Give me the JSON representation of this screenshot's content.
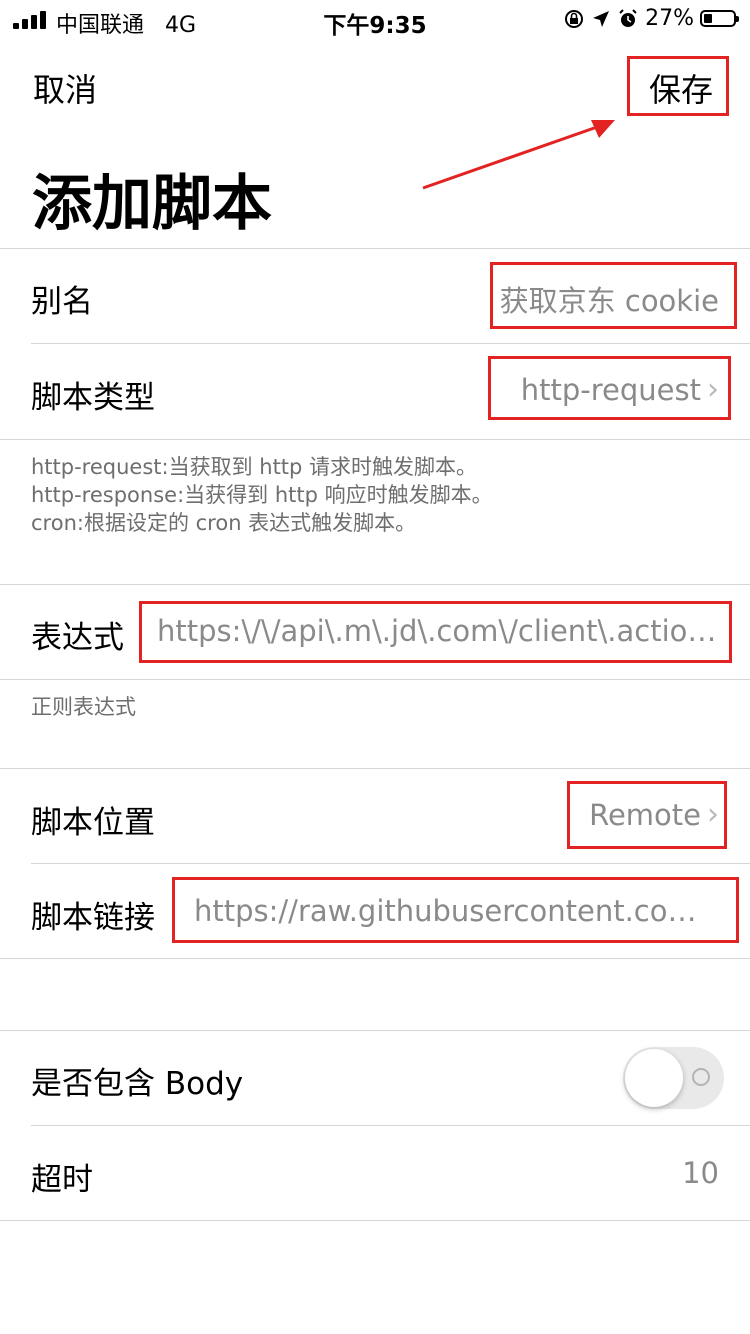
{
  "status_bar": {
    "carrier": "中国联通",
    "network": "4G",
    "time": "下午9:35",
    "battery": "27%",
    "icons": [
      "signal-icon",
      "rotation-lock-icon",
      "location-arrow-icon",
      "alarm-icon",
      "battery-icon"
    ]
  },
  "nav": {
    "cancel_label": "取消",
    "save_label": "保存",
    "title": "添加脚本"
  },
  "form": {
    "alias": {
      "label": "别名",
      "placeholder": "获取京东 cookie"
    },
    "script_type": {
      "label": "脚本类型",
      "value": "http-request"
    },
    "type_notes": [
      "http-request:当获取到 http 请求时触发脚本。",
      "http-response:当获得到 http 响应时触发脚本。",
      "cron:根据设定的 cron 表达式触发脚本。"
    ],
    "expression": {
      "label": "表达式",
      "value": "https:\\/\\/api\\.m\\.jd\\.com\\/client\\.action.*..."
    },
    "expression_note": "正则表达式",
    "script_location": {
      "label": "脚本位置",
      "value": "Remote"
    },
    "script_link": {
      "label": "脚本链接",
      "value": "https://raw.githubusercontent.com/N..."
    },
    "include_body": {
      "label": "是否包含 Body",
      "checked": false
    },
    "timeout": {
      "label": "超时",
      "value": "10"
    }
  },
  "colors": {
    "annotation_red": "#e32222",
    "separator": "#d6d6d6",
    "secondary_text": "#8a8a8a"
  }
}
